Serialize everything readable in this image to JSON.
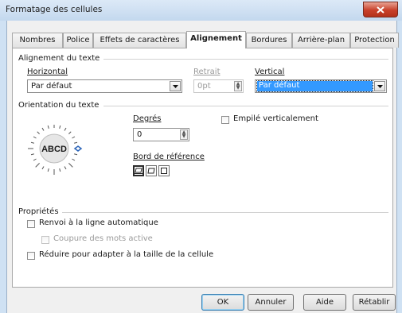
{
  "window": {
    "title": "Formatage des cellules"
  },
  "tabs": [
    {
      "label": "Nombres"
    },
    {
      "label": "Police"
    },
    {
      "label": "Effets de caractères"
    },
    {
      "label": "Alignement"
    },
    {
      "label": "Bordures"
    },
    {
      "label": "Arrière-plan"
    },
    {
      "label": "Protection"
    }
  ],
  "active_tab": "Alignement",
  "text_alignment": {
    "heading": "Alignement du texte",
    "horizontal": {
      "label": "Horizontal",
      "value": "Par défaut"
    },
    "indent": {
      "label": "Retrait",
      "value": "0pt"
    },
    "vertical": {
      "label": "Vertical",
      "value": "Par défaut"
    }
  },
  "text_orientation": {
    "heading": "Orientation du texte",
    "dial_text": "ABCD",
    "degrees": {
      "label": "Degrés",
      "value": "0"
    },
    "stacked": {
      "label": "Empilé verticalement",
      "checked": false
    },
    "reference_edge": {
      "label": "Bord de référence"
    }
  },
  "properties": {
    "heading": "Propriétés",
    "wrap": {
      "label": "Renvoi à la ligne automatique",
      "checked": false
    },
    "hyphenation": {
      "label": "Coupure des mots active",
      "checked": false
    },
    "shrink": {
      "label": "Réduire pour adapter à la taille de la cellule",
      "checked": false
    }
  },
  "buttons": {
    "ok": "OK",
    "cancel": "Annuler",
    "help": "Aide",
    "reset": "Rétablir"
  },
  "colors": {
    "title_bar": "#cfe1f3",
    "selection": "#3399ff",
    "close_button": "#c8402a"
  }
}
